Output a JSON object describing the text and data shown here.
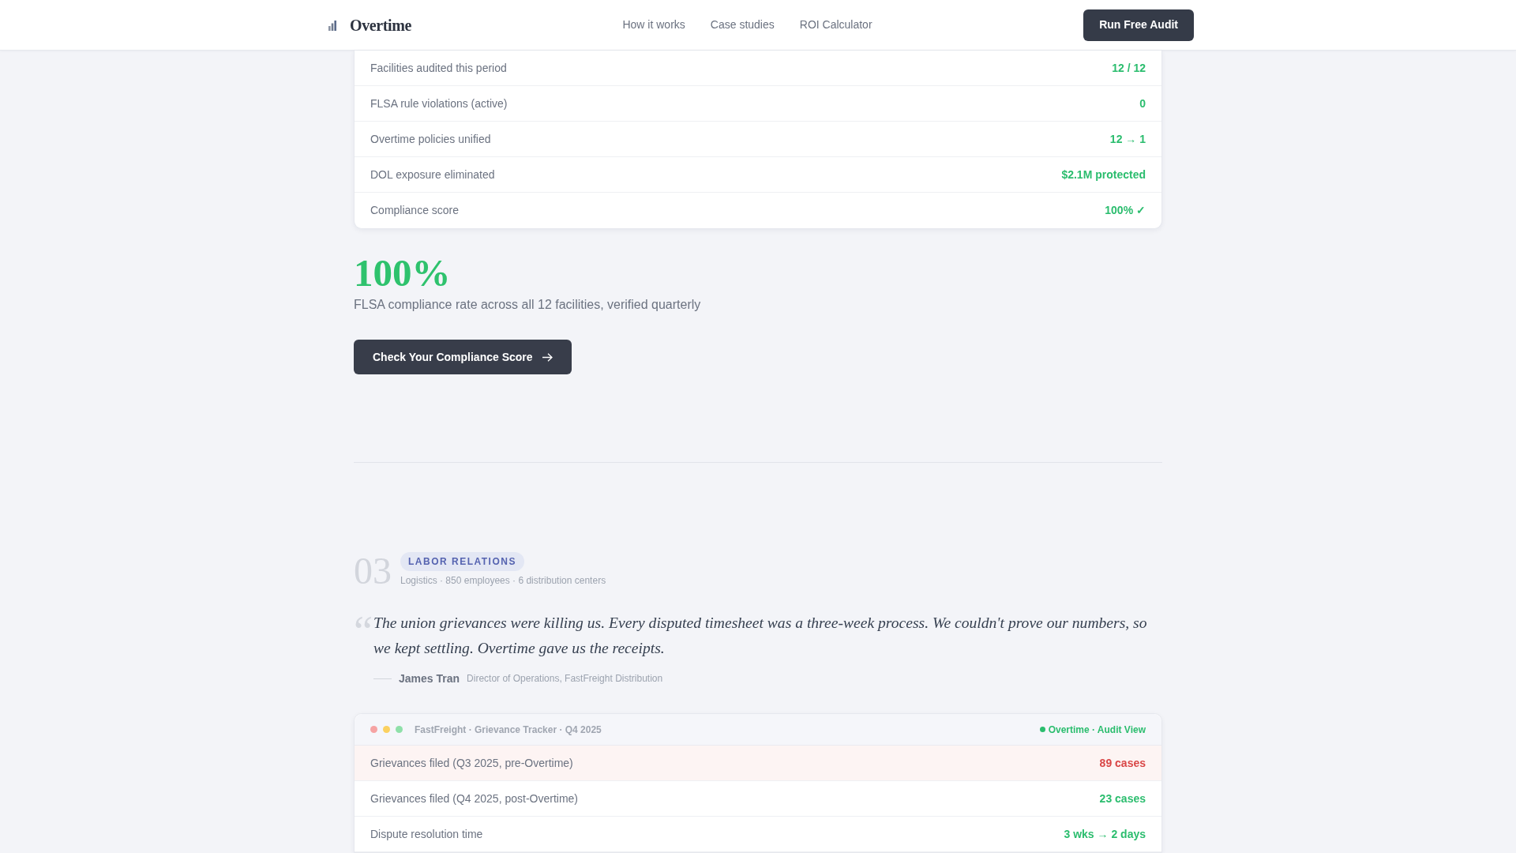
{
  "navbar": {
    "logo": "Overtime",
    "links": [
      "How it works",
      "Case studies",
      "ROI Calculator"
    ],
    "cta": "Run Free Audit"
  },
  "metrics_card": {
    "rows": [
      {
        "label": "Facilities audited this period",
        "value": "12 / 12"
      },
      {
        "label": "FLSA rule violations (active)",
        "value": "0"
      },
      {
        "label": "Overtime policies unified",
        "value": "12 → 1"
      },
      {
        "label": "DOL exposure eliminated",
        "value": "$2.1M protected"
      },
      {
        "label": "Compliance score",
        "value": "100% ✓"
      }
    ]
  },
  "stat": {
    "value": "100%",
    "caption": "FLSA compliance rate across all 12 facilities, verified quarterly"
  },
  "cta_button": "Check Your Compliance Score",
  "case_study": {
    "number": "03",
    "tag": "LABOR RELATIONS",
    "meta": "Logistics · 850 employees · 6 distribution centers",
    "quote_mark": "“",
    "quote": "The union grievances were killing us. Every disputed timesheet was a three-week process. We couldn't prove our numbers, so we kept settling. Overtime gave us the receipts.",
    "author": "James Tran",
    "role": "Director of Operations, FastFreight Distribution",
    "tracker": {
      "title": "FastFreight · Grievance Tracker · Q4 2025",
      "status": "Overtime · Audit View",
      "rows": [
        {
          "label": "Grievances filed (Q3 2025, pre-Overtime)",
          "value": "89 cases",
          "highlighted": true
        },
        {
          "label": "Grievances filed (Q4 2025, post-Overtime)",
          "value": "23 cases",
          "highlighted": false
        },
        {
          "label": "Dispute resolution time",
          "value": "3 wks → 2 days",
          "highlighted": false
        }
      ]
    }
  }
}
